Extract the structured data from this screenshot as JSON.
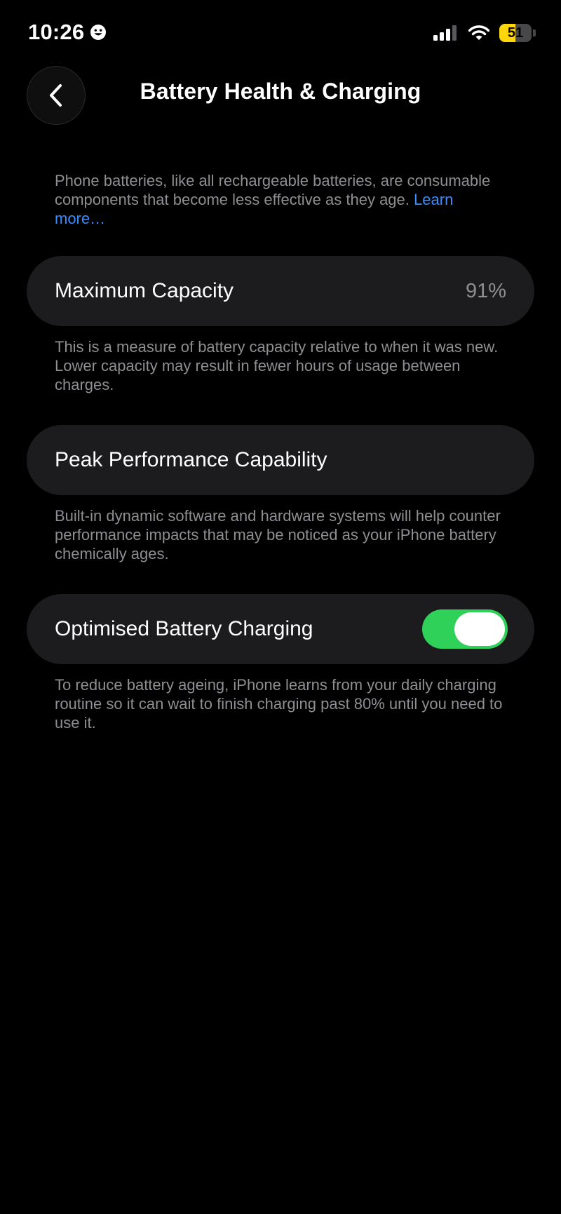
{
  "status_bar": {
    "time": "10:26",
    "focus_icon": "smiley-face-icon",
    "signal_icon": "cellular-signal-icon",
    "wifi_icon": "wifi-icon",
    "battery_percent": "51",
    "battery_level": 0.51,
    "battery_color": "#ffd60a"
  },
  "nav": {
    "back_icon": "chevron-left-icon",
    "title": "Battery Health & Charging"
  },
  "intro": {
    "text": "Phone batteries, like all rechargeable batteries, are consumable components that become less effective as they age.",
    "link_label": "Learn more…"
  },
  "maximum_capacity": {
    "label": "Maximum Capacity",
    "value": "91%",
    "description": "This is a measure of battery capacity relative to when it was new. Lower capacity may result in fewer hours of usage between charges."
  },
  "peak_performance": {
    "label": "Peak Performance Capability",
    "description": "Built-in dynamic software and hardware systems will help counter performance impacts that may be noticed as your iPhone battery chemically ages."
  },
  "optimised_charging": {
    "label": "Optimised Battery Charging",
    "enabled": true,
    "toggle_color": "#30d158",
    "description": "To reduce battery ageing, iPhone learns from your daily charging routine so it can wait to finish charging past 80% until you need to use it."
  },
  "colors": {
    "background": "#000000",
    "row_background": "#1c1c1e",
    "secondary_text": "#8e8e93",
    "link": "#3a8cff"
  }
}
